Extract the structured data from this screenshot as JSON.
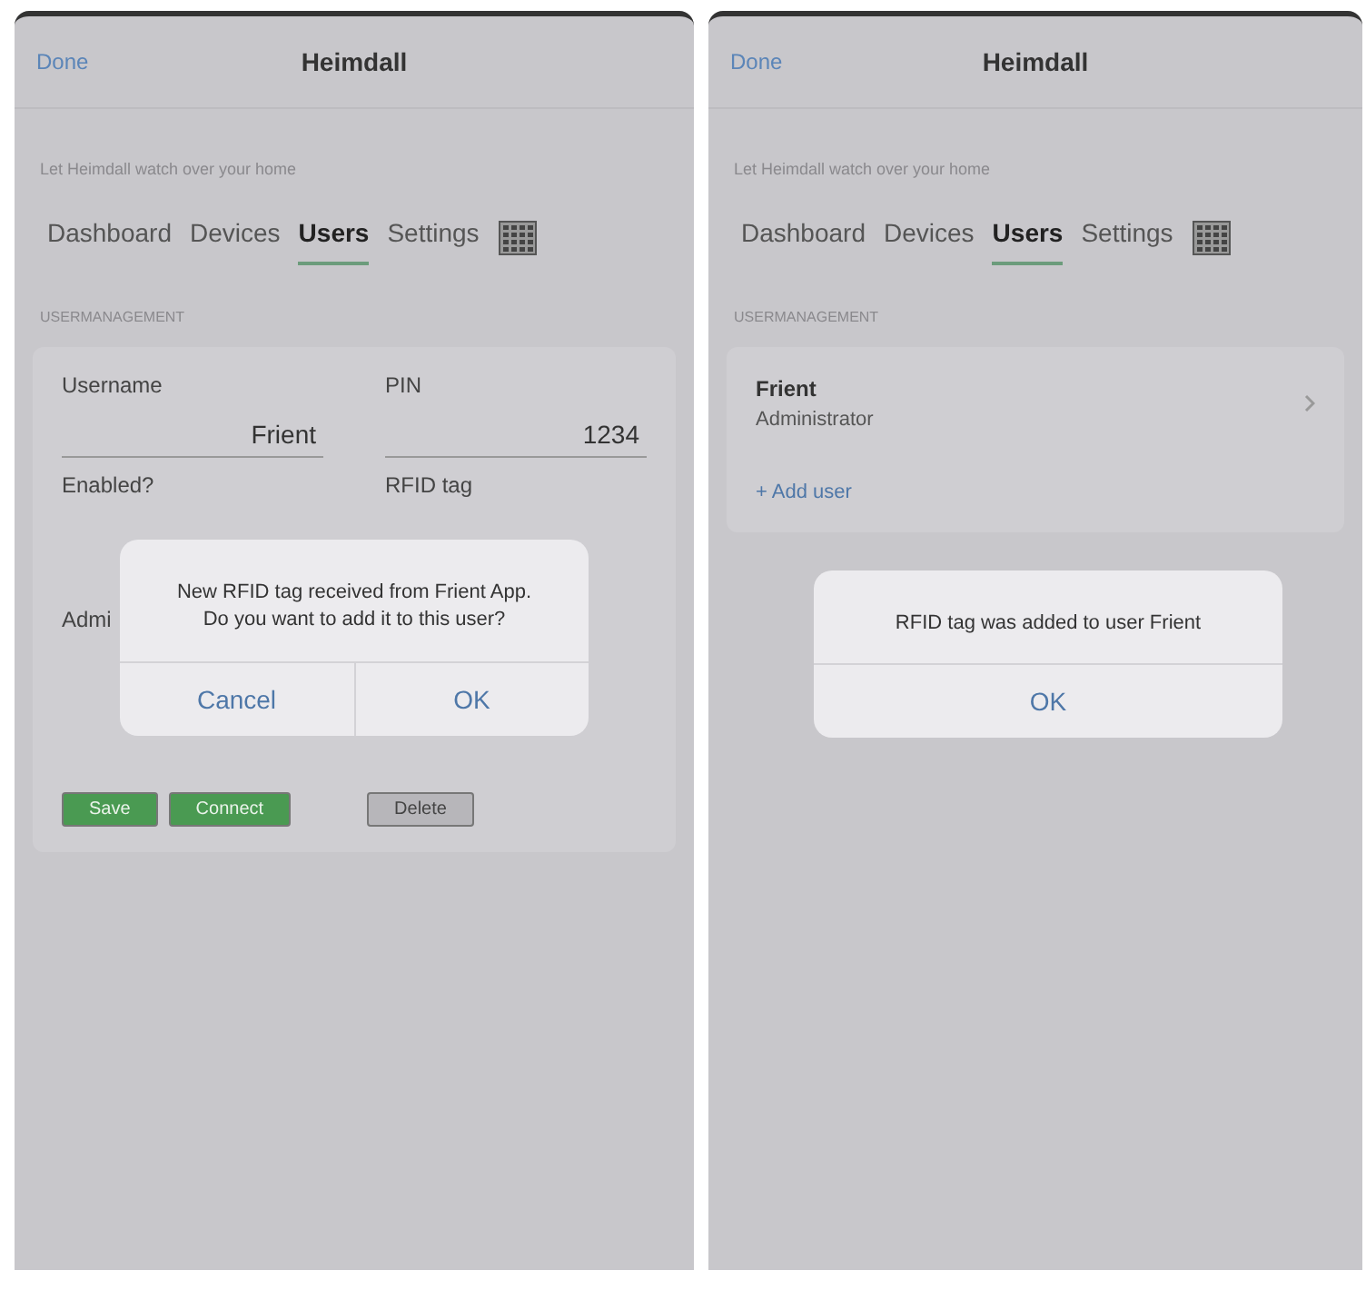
{
  "screens": [
    {
      "kind": "edit",
      "nav": {
        "back": "Done",
        "title": "Heimdall"
      },
      "subtitle": "Let Heimdall watch over your home",
      "tabs": [
        {
          "label": "Dashboard",
          "selected": false
        },
        {
          "label": "Devices",
          "selected": false
        },
        {
          "label": "Users",
          "selected": true
        },
        {
          "label": "Settings",
          "selected": false
        }
      ],
      "section": "USERMANAGEMENT",
      "fields": [
        {
          "label": "Username",
          "value": "Frient"
        },
        {
          "label": "PIN",
          "value": "1234"
        }
      ],
      "labels": [
        "Enabled?",
        "RFID tag",
        "Admi"
      ],
      "buttons": [
        {
          "label": "Save",
          "kind": "primary"
        },
        {
          "label": "Connect",
          "kind": "primary"
        },
        {
          "label": "Delete",
          "kind": "secondary"
        }
      ],
      "dialog": {
        "message": "New RFID tag received from Frient App. Do you want to add it to this user?",
        "actions": [
          "Cancel",
          "OK"
        ]
      }
    },
    {
      "kind": "list",
      "nav": {
        "back": "Done",
        "title": "Heimdall"
      },
      "subtitle": "Let Heimdall watch over your home",
      "tabs": [
        {
          "label": "Dashboard",
          "selected": false
        },
        {
          "label": "Devices",
          "selected": false
        },
        {
          "label": "Users",
          "selected": true
        },
        {
          "label": "Settings",
          "selected": false
        }
      ],
      "section": "USERMANAGEMENT",
      "users": [
        {
          "name": "Frient",
          "role": "Administrator"
        }
      ],
      "add_user": "+ Add user",
      "dialog": {
        "message": "RFID tag was added to user Frient",
        "actions": [
          "OK"
        ]
      }
    }
  ]
}
